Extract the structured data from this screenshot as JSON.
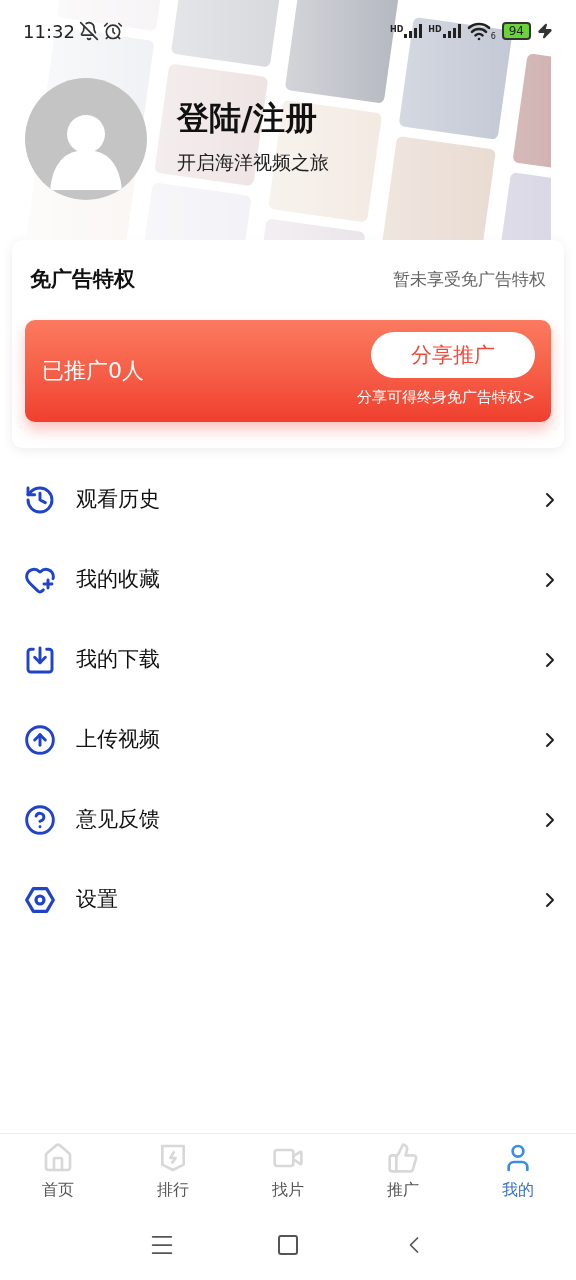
{
  "status_bar": {
    "time": "11:32",
    "network_labels": [
      "HD",
      "HD"
    ],
    "wifi_label": "6",
    "battery": "94"
  },
  "profile": {
    "title": "登陆/注册",
    "subtitle": "开启海洋视频之旅"
  },
  "ad_free": {
    "title": "免广告特权",
    "status": "暂未享受免广告特权",
    "promoted": "已推广0人",
    "share_button": "分享推广",
    "hint": "分享可得终身免广告特权>"
  },
  "menu": [
    {
      "kind": "history",
      "label": "观看历史"
    },
    {
      "kind": "favorites",
      "label": "我的收藏"
    },
    {
      "kind": "download",
      "label": "我的下载"
    },
    {
      "kind": "upload",
      "label": "上传视频"
    },
    {
      "kind": "feedback",
      "label": "意见反馈"
    },
    {
      "kind": "settings",
      "label": "设置"
    }
  ],
  "tab_bar": [
    {
      "kind": "home",
      "label": "首页",
      "selected": false
    },
    {
      "kind": "ranking",
      "label": "排行",
      "selected": false
    },
    {
      "kind": "find",
      "label": "找片",
      "selected": false
    },
    {
      "kind": "promote",
      "label": "推广",
      "selected": false
    },
    {
      "kind": "me",
      "label": "我的",
      "selected": true
    }
  ]
}
